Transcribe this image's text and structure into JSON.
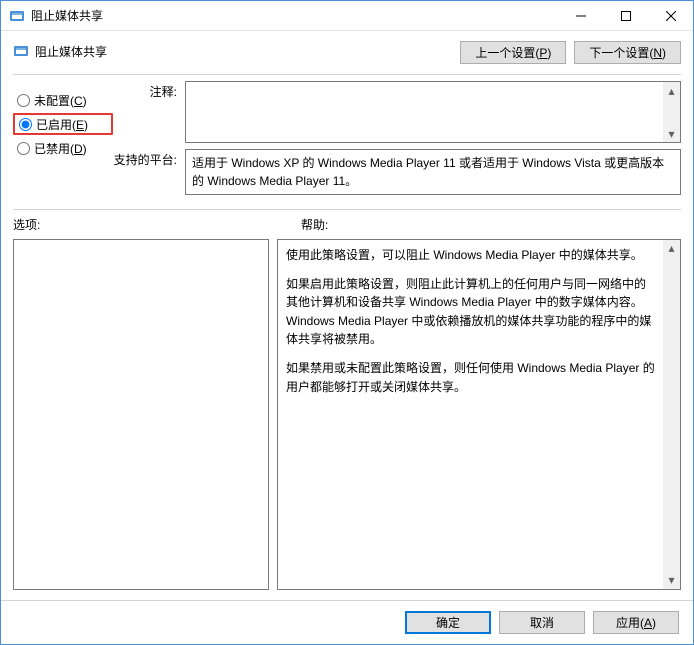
{
  "window": {
    "title": "阻止媒体共享"
  },
  "header": {
    "title": "阻止媒体共享",
    "prev": "上一个设置(P)",
    "next": "下一个设置(N)"
  },
  "radios": {
    "not_configured": "未配置(C)",
    "enabled": "已启用(E)",
    "disabled": "已禁用(D)",
    "selected": "enabled"
  },
  "fields": {
    "comment_label": "注释:",
    "comment_value": "",
    "platform_label": "支持的平台:",
    "platform_value": "适用于 Windows XP 的 Windows Media Player 11 或者适用于 Windows Vista 或更高版本的 Windows Media Player 11。"
  },
  "mid": {
    "options_label": "选项:",
    "help_label": "帮助:",
    "help_paragraphs": [
      "使用此策略设置，可以阻止 Windows Media Player 中的媒体共享。",
      "如果启用此策略设置，则阻止此计算机上的任何用户与同一网络中的其他计算机和设备共享 Windows Media Player 中的数字媒体内容。Windows Media Player 中或依赖播放机的媒体共享功能的程序中的媒体共享将被禁用。",
      "如果禁用或未配置此策略设置，则任何使用 Windows Media Player 的用户都能够打开或关闭媒体共享。"
    ]
  },
  "footer": {
    "ok": "确定",
    "cancel": "取消",
    "apply": "应用(A)"
  }
}
